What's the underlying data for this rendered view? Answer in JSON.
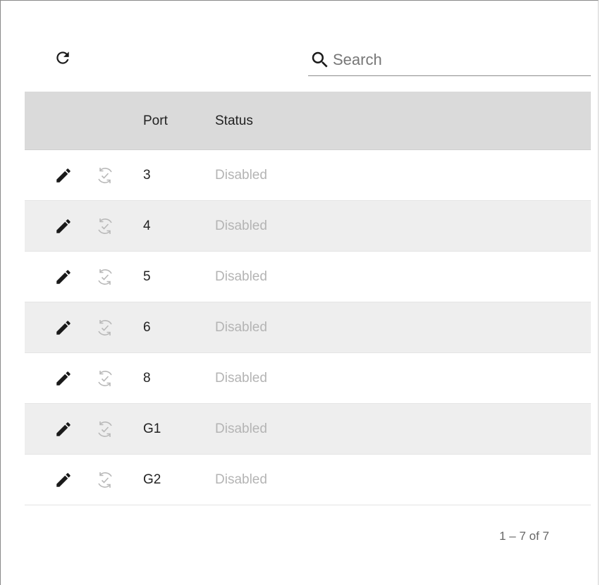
{
  "toolbar": {
    "refresh_icon": "refresh-icon"
  },
  "search": {
    "icon": "search-icon",
    "placeholder": "Search",
    "value": ""
  },
  "table": {
    "columns": {
      "actions": "",
      "port": "Port",
      "status": "Status"
    },
    "rows": [
      {
        "port": "3",
        "status": "Disabled"
      },
      {
        "port": "4",
        "status": "Disabled"
      },
      {
        "port": "5",
        "status": "Disabled"
      },
      {
        "port": "6",
        "status": "Disabled"
      },
      {
        "port": "8",
        "status": "Disabled"
      },
      {
        "port": "G1",
        "status": "Disabled"
      },
      {
        "port": "G2",
        "status": "Disabled"
      }
    ],
    "row_icons": {
      "edit": "edit-icon",
      "sync": "sync-check-icon"
    }
  },
  "pagination": {
    "label": "1 – 7 of 7"
  },
  "colors": {
    "header_bg": "#dadada",
    "alt_row_bg": "#eeeeee",
    "status_disabled": "#b4b4b4",
    "sync_icon": "#b9b9b9",
    "edit_icon": "#1a1a1a"
  }
}
